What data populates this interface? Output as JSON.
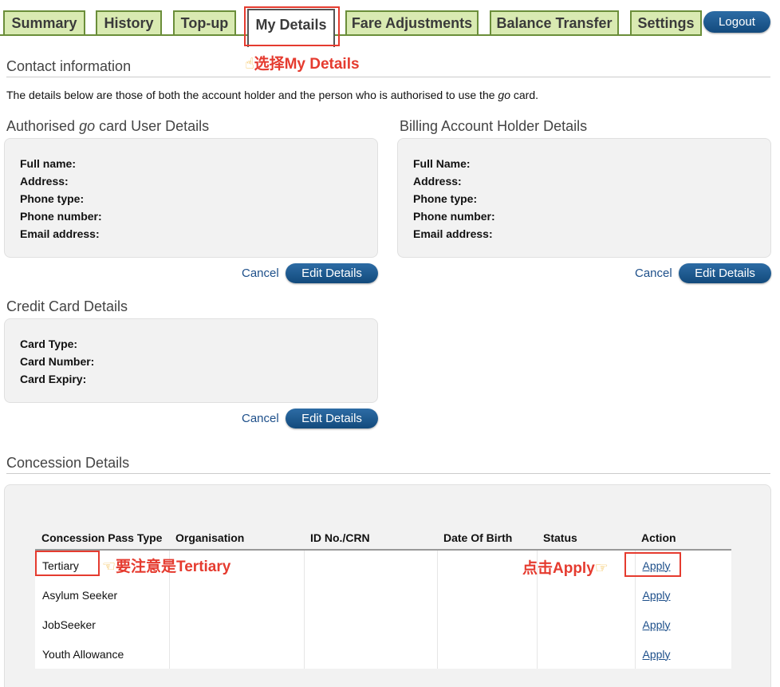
{
  "tabs": [
    {
      "label": "Summary"
    },
    {
      "label": "History"
    },
    {
      "label": "Top-up"
    },
    {
      "label": "My Details"
    },
    {
      "label": "Fare Adjustments"
    },
    {
      "label": "Balance Transfer"
    },
    {
      "label": "Settings"
    }
  ],
  "logout_label": "Logout",
  "annotations": {
    "select_my_details": "选择My Details",
    "note_tertiary": "要注意是Tertiary",
    "click_apply": "点击Apply"
  },
  "contact": {
    "title": "Contact information",
    "intro_before": "The details below are those of both the account holder and the person who is authorised to use the ",
    "intro_em": "go",
    "intro_after": " card."
  },
  "user_details": {
    "title_before": "Authorised ",
    "title_em": "go",
    "title_after": " card User Details",
    "fields": [
      "Full name:",
      "Address:",
      "Phone type:",
      "Phone number:",
      "Email address:"
    ],
    "cancel": "Cancel",
    "edit": "Edit Details"
  },
  "billing_details": {
    "title": "Billing Account Holder Details",
    "fields": [
      "Full Name:",
      "Address:",
      "Phone type:",
      "Phone number:",
      "Email address:"
    ],
    "cancel": "Cancel",
    "edit": "Edit Details"
  },
  "credit_card": {
    "title": "Credit Card Details",
    "fields": [
      "Card Type:",
      "Card Number:",
      "Card Expiry:"
    ],
    "cancel": "Cancel",
    "edit": "Edit Details"
  },
  "concession": {
    "title": "Concession Details",
    "headers": [
      "Concession Pass Type",
      "Organisation",
      "ID No./CRN",
      "Date Of Birth",
      "Status",
      "Action"
    ],
    "rows": [
      {
        "type": "Tertiary",
        "action": "Apply"
      },
      {
        "type": "Asylum Seeker",
        "action": "Apply"
      },
      {
        "type": "JobSeeker",
        "action": "Apply"
      },
      {
        "type": "Youth Allowance",
        "action": "Apply"
      }
    ]
  }
}
